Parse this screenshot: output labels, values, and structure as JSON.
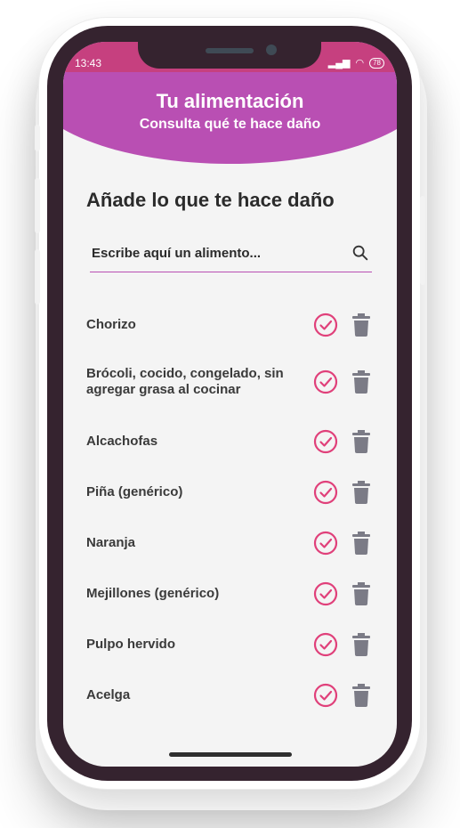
{
  "status_bar": {
    "time": "13:43",
    "battery": "78"
  },
  "header": {
    "title": "Tu alimentación",
    "subtitle": "Consulta qué te hace daño"
  },
  "main": {
    "section_title": "Añade lo que te hace daño",
    "search_placeholder": "Escribe aquí un alimento..."
  },
  "foods": [
    {
      "label": "Chorizo"
    },
    {
      "label": "Brócoli, cocido, congelado, sin agregar grasa al cocinar"
    },
    {
      "label": "Alcachofas"
    },
    {
      "label": "Piña (genérico)"
    },
    {
      "label": "Naranja"
    },
    {
      "label": "Mejillones (genérico)"
    },
    {
      "label": "Pulpo hervido"
    },
    {
      "label": "Acelga"
    }
  ],
  "colors": {
    "header": "#b94fb3",
    "status_bar": "#c6407f",
    "check_icon": "#e0407a",
    "trash_icon": "#7b7b86"
  }
}
